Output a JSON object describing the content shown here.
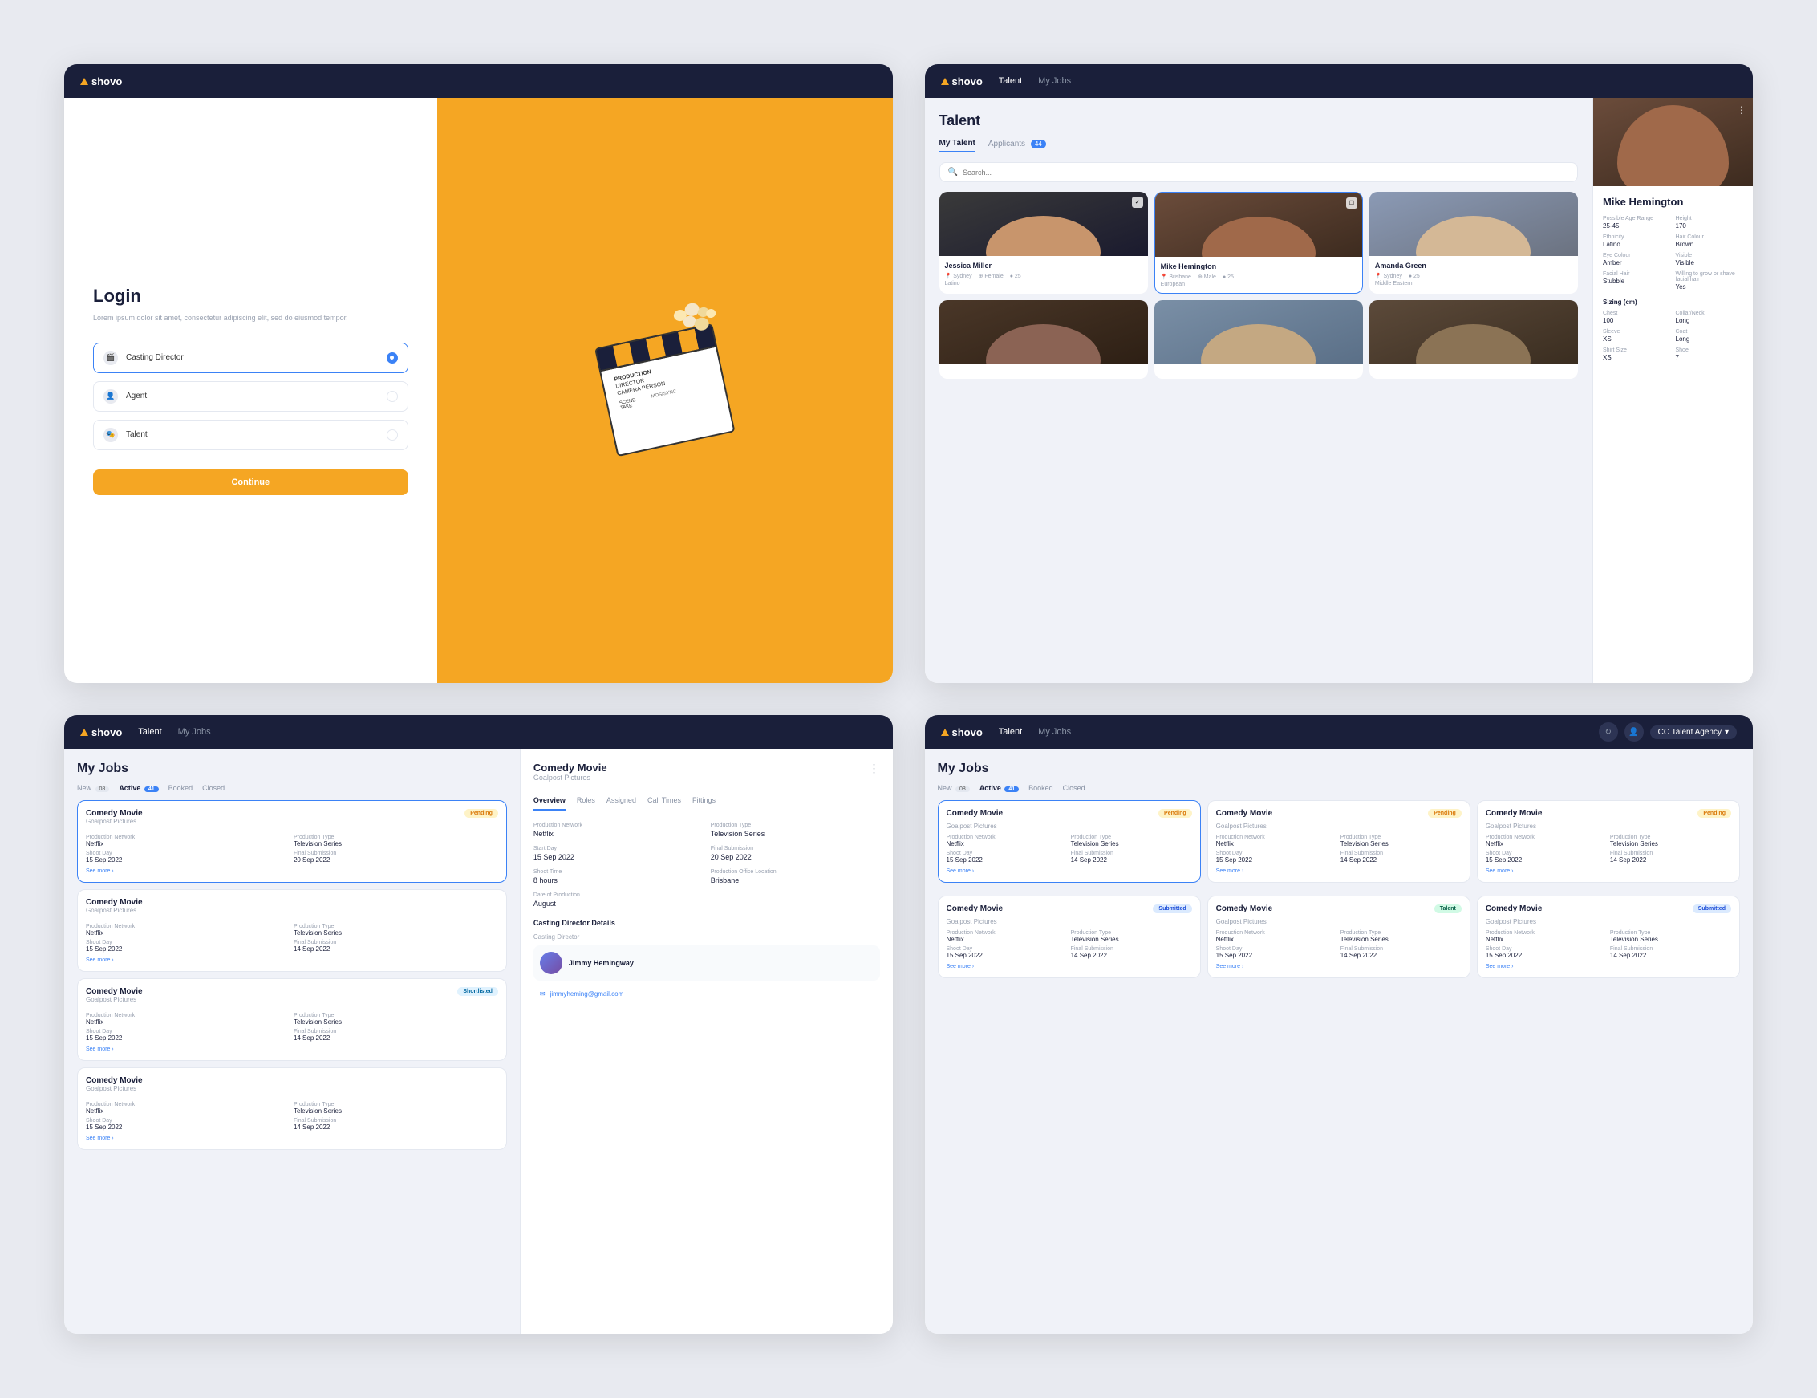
{
  "screens": {
    "screen1": {
      "nav": {
        "logo": "shovo"
      },
      "title": "Login",
      "subtitle": "Lorem ipsum dolor sit amet, consectetur adipiscing elit, sed do eiusmod tempor.",
      "options": [
        {
          "id": "casting-director",
          "label": "Casting Director",
          "selected": true
        },
        {
          "id": "agent",
          "label": "Agent",
          "selected": false
        },
        {
          "id": "talent",
          "label": "Talent",
          "selected": false
        }
      ],
      "continue_btn": "Continue"
    },
    "screen2": {
      "nav": {
        "logo": "shovo",
        "links": [
          "Talent",
          "My Jobs"
        ]
      },
      "title": "Talent",
      "tabs": [
        {
          "label": "My Talent",
          "active": true
        },
        {
          "label": "Applicants",
          "count": "44",
          "active": false
        }
      ],
      "search_placeholder": "Search...",
      "talents": [
        {
          "name": "Jessica Miller",
          "location": "Sydney",
          "gender": "Female",
          "ethnicity": "Latino",
          "age": "25"
        },
        {
          "name": "Mike Hemington",
          "location": "Brisbane",
          "gender": "Male",
          "ethnicity": "European",
          "age": "25"
        },
        {
          "name": "Amanda Green",
          "location": "Sydney",
          "gender": "",
          "ethnicity": "Middle Eastern",
          "age": "25"
        },
        {
          "name": "",
          "location": "",
          "gender": "",
          "ethnicity": "",
          "age": ""
        },
        {
          "name": "",
          "location": "",
          "gender": "",
          "ethnicity": "",
          "age": ""
        },
        {
          "name": "",
          "location": "",
          "gender": "",
          "ethnicity": "",
          "age": ""
        }
      ],
      "detail": {
        "name": "Mike Hemington",
        "fields": [
          {
            "label": "Possible Age Range",
            "value": "25-45"
          },
          {
            "label": "Height",
            "value": "170"
          },
          {
            "label": "Ethnicity",
            "value": "Latino"
          },
          {
            "label": "Hair Colour",
            "value": "Brown"
          },
          {
            "label": "Eye Colour",
            "value": "Amber"
          },
          {
            "label": "Visible",
            "value": "Visible"
          },
          {
            "label": "Facial Hair",
            "value": "Stubble"
          },
          {
            "label": "Willing to grow or shave facial hair",
            "value": "Yes"
          }
        ],
        "sizing_label": "Sizing (cm)",
        "sizing_fields": [
          {
            "label": "Chest",
            "value": "100"
          },
          {
            "label": "Collar/Neck",
            "value": "Long"
          },
          {
            "label": "Sleeve",
            "value": "XS"
          },
          {
            "label": "Coat",
            "value": "Long"
          },
          {
            "label": "Shirt Size",
            "value": "XS"
          },
          {
            "label": "Shoe",
            "value": "7"
          }
        ]
      }
    },
    "screen3": {
      "nav": {
        "logo": "shovo",
        "links": [
          "Talent",
          "My Jobs"
        ]
      },
      "title": "My Jobs",
      "status_tabs": [
        {
          "label": "New",
          "count": "08",
          "active": false
        },
        {
          "label": "Active",
          "count": "41",
          "active": true
        },
        {
          "label": "Booked",
          "active": false
        },
        {
          "label": "Closed",
          "active": false
        }
      ],
      "jobs": [
        {
          "title": "Comedy Movie",
          "company": "Goalpost Pictures",
          "status": "Pending",
          "status_type": "pending",
          "selected": true,
          "prod_network_label": "Production Network",
          "prod_network": "Netflix",
          "prod_type_label": "Production Type",
          "prod_type": "Television Series",
          "shoot_label": "Shoot Day",
          "shoot": "15 Sep 2022",
          "submission_label": "Final Submission",
          "submission": "20 Sep 2022"
        },
        {
          "title": "Comedy Movie",
          "company": "Goalpost Pictures",
          "status": "",
          "status_type": "",
          "selected": false,
          "prod_network_label": "Production Network",
          "prod_network": "Netflix",
          "prod_type_label": "Production Type",
          "prod_type": "Television Series",
          "shoot_label": "Shoot Day",
          "shoot": "15 Sep 2022",
          "submission_label": "Final Submission",
          "submission": "14 Sep 2022"
        },
        {
          "title": "Comedy Movie",
          "company": "Goalpost Pictures",
          "status": "Shortlisted",
          "status_type": "shortlisted",
          "selected": false,
          "prod_network_label": "Production Network",
          "prod_network": "Netflix",
          "prod_type_label": "Production Type",
          "prod_type": "Television Series",
          "shoot_label": "Shoot Day",
          "shoot": "15 Sep 2022",
          "submission_label": "Final Submission",
          "submission": "14 Sep 2022"
        },
        {
          "title": "Comedy Movie",
          "company": "Goalpost Pictures",
          "status": "",
          "status_type": "",
          "selected": false,
          "prod_network_label": "Production Network",
          "prod_network": "Netflix",
          "prod_type_label": "Production Type",
          "prod_type": "Television Series",
          "shoot_label": "Shoot Day",
          "shoot": "15 Sep 2022",
          "submission_label": "Final Submission",
          "submission": "14 Sep 2022"
        }
      ],
      "detail": {
        "title": "Comedy Movie",
        "company": "Goalpost Pictures",
        "tabs": [
          "Overview",
          "Roles",
          "Assigned",
          "Call Times",
          "Fittings"
        ],
        "active_tab": "Overview",
        "fields": [
          {
            "label": "Production Network",
            "value": "Netflix"
          },
          {
            "label": "Production Type",
            "value": "Television Series"
          },
          {
            "label": "Start Day",
            "value": "15 Sep 2022"
          },
          {
            "label": "Final Submission",
            "value": "20 Sep 2022"
          },
          {
            "label": "Shoot Time",
            "value": "8 hours"
          },
          {
            "label": "Production Office Location",
            "value": "Brisbane"
          },
          {
            "label": "Date of Production",
            "value": "August"
          }
        ],
        "casting_director_label": "Casting Director Details",
        "casting_director": {
          "sub_label": "Casting Director",
          "name": "Jimmy Hemingway",
          "email": "jimmyheming@gmail.com"
        }
      }
    },
    "screen4": {
      "nav": {
        "logo": "shovo",
        "links": [
          "Talent",
          "My Jobs"
        ],
        "agency": "CC Talent Agency"
      },
      "title": "My Jobs",
      "status_tabs": [
        {
          "label": "New",
          "count": "08",
          "active": false
        },
        {
          "label": "Active",
          "count": "41",
          "active": true
        },
        {
          "label": "Booked",
          "active": false
        },
        {
          "label": "Closed",
          "active": false
        }
      ],
      "jobs": [
        {
          "title": "Comedy Movie",
          "company": "Goalpost Pictures",
          "status": "Pending",
          "status_type": "pending",
          "prod_network": "Netflix",
          "prod_type": "Television Series",
          "shoot": "15 Sep 2022",
          "submission": "14 Sep 2022"
        },
        {
          "title": "Comedy Movie",
          "company": "Goalpost Pictures",
          "status": "Pending",
          "status_type": "pending",
          "prod_network": "Netflix",
          "prod_type": "Television Series",
          "shoot": "15 Sep 2022",
          "submission": "14 Sep 2022"
        },
        {
          "title": "Comedy Movie",
          "company": "Goalpost Pictures",
          "status": "Pending",
          "status_type": "pending",
          "prod_network": "Netflix",
          "prod_type": "Television Series",
          "shoot": "15 Sep 2022",
          "submission": "14 Sep 2022"
        },
        {
          "title": "Comedy Movie",
          "company": "Goalpost Pictures",
          "status": "Submitted",
          "status_type": "submitted",
          "prod_network": "Netflix",
          "prod_type": "Television Series",
          "shoot": "15 Sep 2022",
          "submission": "14 Sep 2022"
        },
        {
          "title": "Comedy Movie",
          "company": "Goalpost Pictures",
          "status": "Talent",
          "status_type": "talent",
          "prod_network": "Netflix",
          "prod_type": "Television Series",
          "shoot": "15 Sep 2022",
          "submission": "14 Sep 2022"
        },
        {
          "title": "Comedy Movie",
          "company": "Goalpost Pictures",
          "status": "Submitted",
          "status_type": "submitted",
          "prod_network": "Netflix",
          "prod_type": "Television Series",
          "shoot": "15 Sep 2022",
          "submission": "14 Sep 2022"
        }
      ]
    }
  },
  "colors": {
    "dark_navy": "#1a1f3a",
    "accent_blue": "#3b82f6",
    "accent_orange": "#f5a623",
    "light_bg": "#f0f2f8",
    "text_muted": "#9aa2b1",
    "border": "#e4e8f0"
  }
}
